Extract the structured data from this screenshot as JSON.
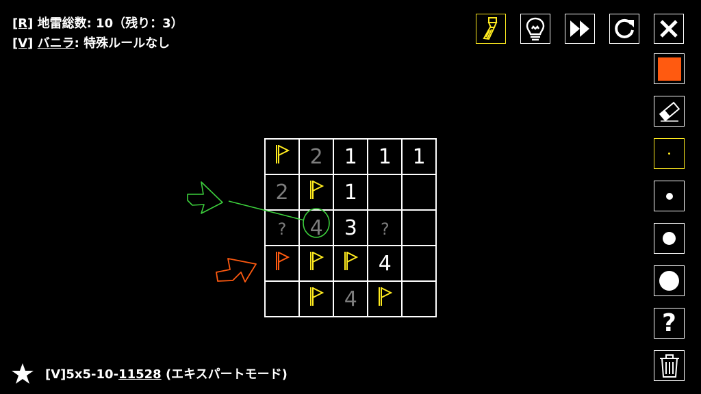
{
  "rules": {
    "line1": {
      "key": "[R]",
      "text": " 地雷総数:  10（残り：3）"
    },
    "line2": {
      "key": "[V]",
      "name": "バニラ",
      "text": ": 特殊ルールなし"
    }
  },
  "toolbar_top": [
    {
      "name": "paint-brush-icon",
      "active": true
    },
    {
      "name": "lightbulb-hint-icon",
      "active": false
    },
    {
      "name": "fast-forward-icon",
      "active": false
    },
    {
      "name": "restart-icon",
      "active": false
    },
    {
      "name": "close-icon",
      "active": false
    }
  ],
  "toolbar_side": [
    {
      "name": "orange-color-icon",
      "active": false
    },
    {
      "name": "eraser-icon",
      "active": false
    },
    {
      "name": "tiny-dot-icon",
      "active": true
    },
    {
      "name": "small-dot-icon",
      "active": false
    },
    {
      "name": "medium-dot-icon",
      "active": false
    },
    {
      "name": "large-dot-icon",
      "active": false
    },
    {
      "name": "question-mark-icon",
      "active": false,
      "label": "?"
    },
    {
      "name": "trash-icon",
      "active": false
    }
  ],
  "board": {
    "rows": 5,
    "cols": 5,
    "cells": [
      [
        {
          "t": "flag"
        },
        {
          "t": "num",
          "v": "2",
          "dim": true
        },
        {
          "t": "num",
          "v": "1"
        },
        {
          "t": "num",
          "v": "1"
        },
        {
          "t": "num",
          "v": "1"
        }
      ],
      [
        {
          "t": "num",
          "v": "2",
          "dim": true
        },
        {
          "t": "flag"
        },
        {
          "t": "num",
          "v": "1"
        },
        {
          "t": "empty"
        },
        {
          "t": "empty"
        }
      ],
      [
        {
          "t": "q",
          "v": "?"
        },
        {
          "t": "num",
          "v": "4",
          "dim": true
        },
        {
          "t": "num",
          "v": "3"
        },
        {
          "t": "q",
          "v": "?"
        },
        {
          "t": "empty"
        }
      ],
      [
        {
          "t": "flag-orange"
        },
        {
          "t": "flag"
        },
        {
          "t": "flag"
        },
        {
          "t": "num",
          "v": "4"
        },
        {
          "t": "empty"
        }
      ],
      [
        {
          "t": "empty"
        },
        {
          "t": "flag"
        },
        {
          "t": "num",
          "v": "4",
          "dim": true
        },
        {
          "t": "flag"
        },
        {
          "t": "empty"
        }
      ]
    ]
  },
  "footer": {
    "prefix": "[V]5x5-10-",
    "id": "11528",
    "mode": " (エキスパートモード)"
  },
  "colors": {
    "flag": "#ffeb1f",
    "orange": "#ff5a10",
    "green": "#3ccf3c",
    "dim": "#7d7d7d"
  }
}
